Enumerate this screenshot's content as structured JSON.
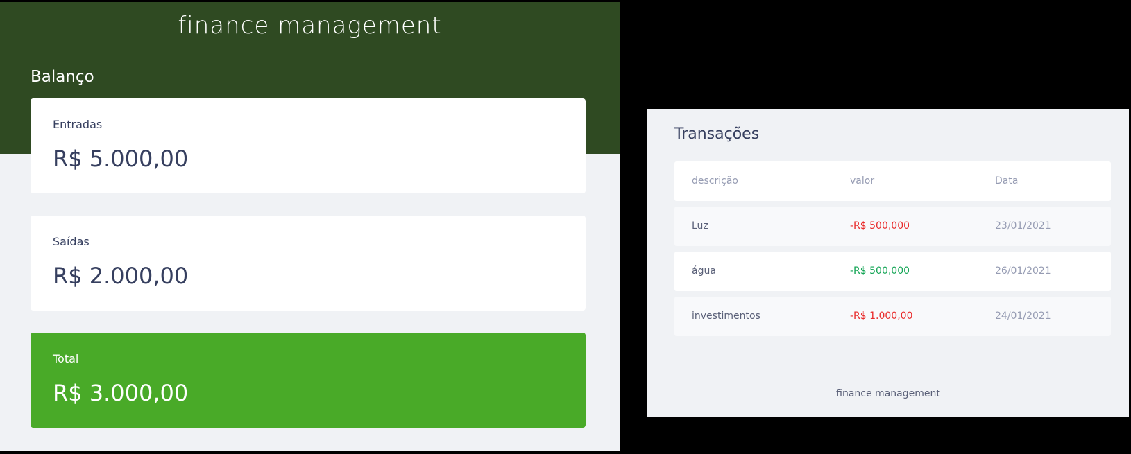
{
  "app": {
    "title": "finance management"
  },
  "balance": {
    "title": "Balanço",
    "cards": {
      "income": {
        "label": "Entradas",
        "value": "R$ 5.000,00"
      },
      "expense": {
        "label": "Saídas",
        "value": "R$ 2.000,00"
      },
      "total": {
        "label": "Total",
        "value": "R$ 3.000,00"
      }
    }
  },
  "transactions": {
    "title": "Transações",
    "headers": {
      "description": "descrição",
      "amount": "valor",
      "date": "Data"
    },
    "rows": [
      {
        "description": "Luz",
        "amount": "-R$ 500,000",
        "date": "23/01/2021"
      },
      {
        "description": "água",
        "amount": "-R$ 500,000",
        "date": "26/01/2021"
      },
      {
        "description": "investimentos",
        "amount": "-R$ 1.000,00",
        "date": "24/01/2021"
      }
    ],
    "footer": "finance management"
  },
  "colors": {
    "header_band": "#2f4a22",
    "total_card": "#49aa28",
    "negative": "#e92929",
    "positive": "#12a454",
    "text_primary": "#363f5f"
  }
}
